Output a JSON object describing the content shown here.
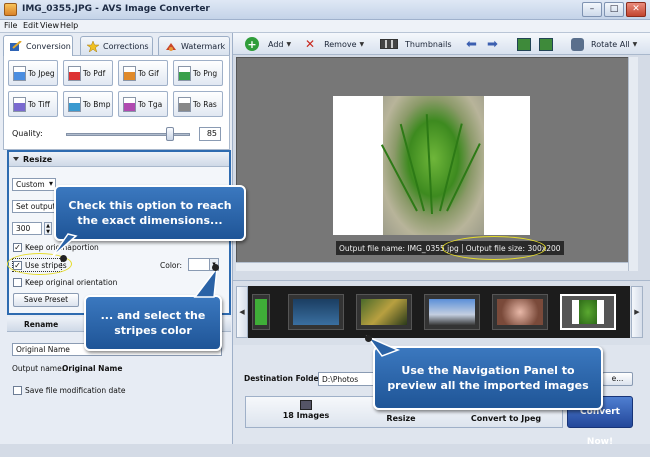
{
  "window": {
    "title": "IMG_0355.JPG - AVS Image Converter",
    "minimize": "–",
    "maximize": "□",
    "close": "✕"
  },
  "menu": [
    "File",
    "Edit",
    "View",
    "Help"
  ],
  "tabs": [
    {
      "label": "Conversion",
      "icon": "conversion-icon",
      "active": true
    },
    {
      "label": "Corrections",
      "icon": "star-icon",
      "active": false
    },
    {
      "label": "Watermark",
      "icon": "watermark-icon",
      "active": false
    }
  ],
  "toolbar": {
    "add_label": "Add",
    "add_symbol": "+",
    "remove_label": "Remove",
    "remove_symbol": "✕",
    "thumbnails_label": "Thumbnails",
    "rotate_all_label": "Rotate All"
  },
  "formats": [
    "To Jpeg",
    "To Pdf",
    "To Gif",
    "To Png",
    "To Tiff",
    "To Bmp",
    "To Tga",
    "To Ras"
  ],
  "quality": {
    "label": "Quality:",
    "value": "85"
  },
  "resize": {
    "header": "Resize",
    "preset": "Custom",
    "set_output": "Set output :",
    "width_value": "300",
    "keep_original_prefix": "Keep origina",
    "keep_original_suffix": "portion",
    "use_stripes_label": "Use stripes",
    "color_label": "Color:",
    "keep_orientation_label": "Keep original orientation",
    "save_preset": "Save Preset"
  },
  "rename": {
    "header": "Rename",
    "value": "Original Name",
    "output_name_label": "Output name:",
    "output_name_value": "Original Name"
  },
  "save_date_label": "Save file modification date",
  "callouts": {
    "check_option": "Check this option to reach the exact dimensions...",
    "stripes_color": "... and select the stripes color",
    "navigation": "Use the Navigation Panel to preview all the imported images"
  },
  "preview": {
    "output_file_name": "Output file name: IMG_0355.jpg",
    "output_file_size": "Output file size: 300x200"
  },
  "destination": {
    "label": "Destination Folder:",
    "value": "D:\\Photos",
    "browse": "e..."
  },
  "steps": [
    {
      "label": "18 Images"
    },
    {
      "label": "Resize"
    },
    {
      "label": "Convert to Jpeg"
    }
  ],
  "convert_button": "Convert Now!"
}
